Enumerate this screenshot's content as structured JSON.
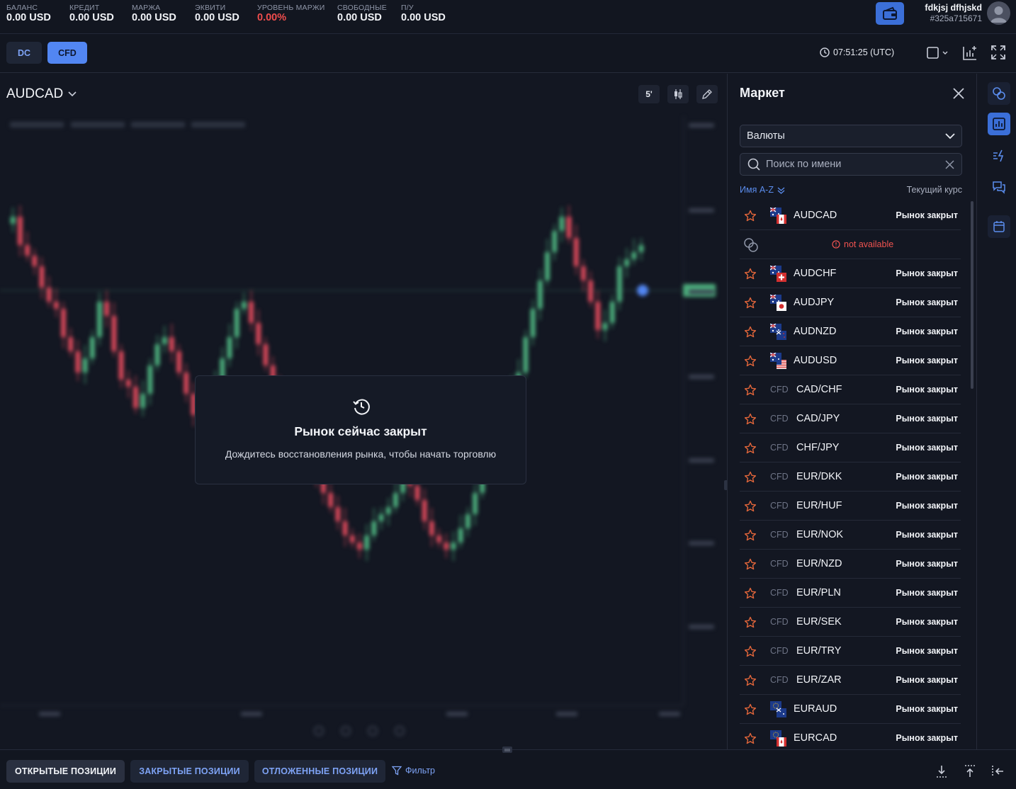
{
  "account": {
    "metrics": [
      {
        "label": "БАЛАНС",
        "value": "0.00 USD",
        "highlight": false
      },
      {
        "label": "КРЕДИТ",
        "value": "0.00 USD",
        "highlight": false
      },
      {
        "label": "МАРЖА",
        "value": "0.00 USD",
        "highlight": false
      },
      {
        "label": "ЭКВИТИ",
        "value": "0.00 USD",
        "highlight": false
      },
      {
        "label": "УРОВЕНЬ МАРЖИ",
        "value": "0.00%",
        "highlight": true
      },
      {
        "label": "СВОБОДНЫЕ",
        "value": "0.00 USD",
        "highlight": false
      },
      {
        "label": "П/У",
        "value": "0.00 USD",
        "highlight": false
      }
    ]
  },
  "user": {
    "name": "fdkjsj dfhjskd",
    "id": "#325a715671"
  },
  "toolbar": {
    "dc_label": "DC",
    "cfd_label": "CFD",
    "active_account_type": "CFD",
    "clock": "07:51:25 (UTC)"
  },
  "chart": {
    "symbol": "AUDCAD",
    "timeframe": "5'",
    "closed_title": "Рынок сейчас закрыт",
    "closed_subtitle": "Дождитесь восстановления рынка, чтобы начать торговлю"
  },
  "market": {
    "title": "Маркет",
    "category": "Валюты",
    "search_placeholder": "Поиск по имени",
    "sort_label": "Имя A-Z",
    "rate_header": "Текущий курс",
    "not_available": "not available",
    "cfd_tag": "CFD",
    "items": [
      {
        "symbol": "AUDCAD",
        "status": "Рынок закрыт",
        "type": "flag",
        "flag": "au-ca"
      },
      {
        "symbol": "AUDCHF",
        "status": "Рынок закрыт",
        "type": "flag",
        "flag": "au-ch"
      },
      {
        "symbol": "AUDJPY",
        "status": "Рынок закрыт",
        "type": "flag",
        "flag": "au-jp"
      },
      {
        "symbol": "AUDNZD",
        "status": "Рынок закрыт",
        "type": "flag",
        "flag": "au-nz"
      },
      {
        "symbol": "AUDUSD",
        "status": "Рынок закрыт",
        "type": "flag",
        "flag": "au-us"
      },
      {
        "symbol": "CAD/CHF",
        "status": "Рынок закрыт",
        "type": "cfd"
      },
      {
        "symbol": "CAD/JPY",
        "status": "Рынок закрыт",
        "type": "cfd"
      },
      {
        "symbol": "CHF/JPY",
        "status": "Рынок закрыт",
        "type": "cfd"
      },
      {
        "symbol": "EUR/DKK",
        "status": "Рынок закрыт",
        "type": "cfd"
      },
      {
        "symbol": "EUR/HUF",
        "status": "Рынок закрыт",
        "type": "cfd"
      },
      {
        "symbol": "EUR/NOK",
        "status": "Рынок закрыт",
        "type": "cfd"
      },
      {
        "symbol": "EUR/NZD",
        "status": "Рынок закрыт",
        "type": "cfd"
      },
      {
        "symbol": "EUR/PLN",
        "status": "Рынок закрыт",
        "type": "cfd"
      },
      {
        "symbol": "EUR/SEK",
        "status": "Рынок закрыт",
        "type": "cfd"
      },
      {
        "symbol": "EUR/TRY",
        "status": "Рынок закрыт",
        "type": "cfd"
      },
      {
        "symbol": "EUR/ZAR",
        "status": "Рынок закрыт",
        "type": "cfd"
      },
      {
        "symbol": "EURAUD",
        "status": "Рынок закрыт",
        "type": "flag",
        "flag": "eu-au"
      },
      {
        "symbol": "EURCAD",
        "status": "Рынок закрыт",
        "type": "flag",
        "flag": "eu-ca"
      }
    ]
  },
  "positions": {
    "tabs": [
      {
        "label": "ОТКРЫТЫЕ ПОЗИЦИИ",
        "active": true
      },
      {
        "label": "ЗАКРЫТЫЕ ПОЗИЦИИ",
        "active": false
      },
      {
        "label": "ОТЛОЖЕННЫЕ ПОЗИЦИИ",
        "active": false
      }
    ],
    "filter_label": "Фильтр"
  },
  "colors": {
    "accent": "#5286f2",
    "loss": "#f04d4d",
    "star": "#e0653a",
    "bull": "#4caf7d",
    "bear": "#d9485a"
  }
}
